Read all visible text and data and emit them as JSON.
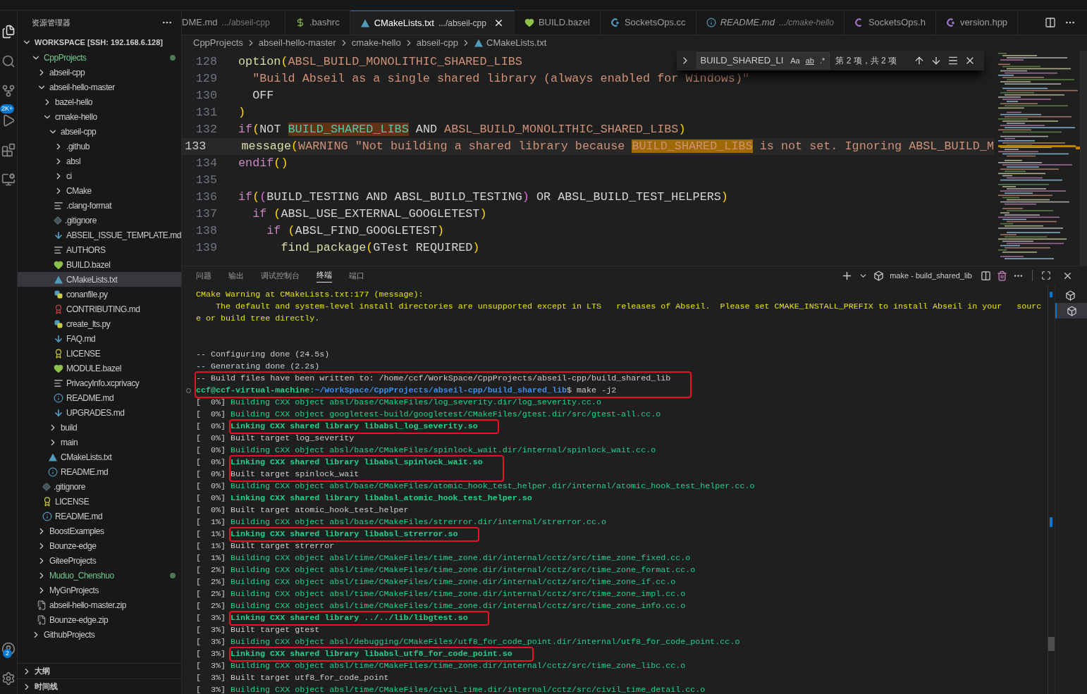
{
  "activity_bar": {
    "badges": [
      {
        "text": "2K+"
      },
      {
        "text": "2"
      }
    ]
  },
  "sidebar": {
    "title": "资源管理器",
    "workspace": {
      "label": "WORKSPACE [SSH: 192.168.6.128]",
      "expanded": true,
      "children": [
        {
          "label": "CppProjects",
          "kind": "folder",
          "expanded": true,
          "selected": false,
          "modified": true,
          "children": [
            {
              "label": "abseil-cpp",
              "kind": "folder",
              "expanded": false,
              "selected": false,
              "modified": false
            },
            {
              "label": "abseil-hello-master",
              "kind": "folder",
              "expanded": true,
              "selected": false,
              "modified": false,
              "children": [
                {
                  "label": "bazel-hello",
                  "kind": "folder",
                  "expanded": false,
                  "selected": false,
                  "modified": false
                },
                {
                  "label": "cmake-hello",
                  "kind": "folder",
                  "expanded": true,
                  "selected": false,
                  "modified": false,
                  "children": [
                    {
                      "label": "abseil-cpp",
                      "kind": "folder",
                      "expanded": true,
                      "selected": false,
                      "modified": false,
                      "children": [
                        {
                          "label": ".github",
                          "kind": "folder",
                          "expanded": false,
                          "selected": false,
                          "modified": false
                        },
                        {
                          "label": "absl",
                          "kind": "folder",
                          "expanded": false,
                          "selected": false,
                          "modified": false
                        },
                        {
                          "label": "ci",
                          "kind": "folder",
                          "expanded": false,
                          "selected": false,
                          "modified": false
                        },
                        {
                          "label": "CMake",
                          "kind": "folder",
                          "expanded": false,
                          "selected": false,
                          "modified": false
                        },
                        {
                          "label": ".clang-format",
                          "kind": "lines",
                          "selected": false,
                          "modified": false
                        },
                        {
                          "label": ".gitignore",
                          "kind": "git",
                          "selected": false,
                          "modified": false
                        },
                        {
                          "label": "ABSEIL_ISSUE_TEMPLATE.md",
                          "kind": "markdown",
                          "selected": false,
                          "modified": false
                        },
                        {
                          "label": "AUTHORS",
                          "kind": "lines",
                          "selected": false,
                          "modified": false
                        },
                        {
                          "label": "BUILD.bazel",
                          "kind": "bazel",
                          "selected": false,
                          "modified": false
                        },
                        {
                          "label": "CMakeLists.txt",
                          "kind": "cmake",
                          "selected": true,
                          "modified": false
                        },
                        {
                          "label": "conanfile.py",
                          "kind": "python",
                          "selected": false,
                          "modified": false
                        },
                        {
                          "label": "CONTRIBUTING.md",
                          "kind": "contributing",
                          "selected": false,
                          "modified": false
                        },
                        {
                          "label": "create_lts.py",
                          "kind": "python",
                          "selected": false,
                          "modified": false
                        },
                        {
                          "label": "FAQ.md",
                          "kind": "markdown",
                          "selected": false,
                          "modified": false
                        },
                        {
                          "label": "LICENSE",
                          "kind": "license",
                          "selected": false,
                          "modified": false
                        },
                        {
                          "label": "MODULE.bazel",
                          "kind": "bazel",
                          "selected": false,
                          "modified": false
                        },
                        {
                          "label": "PrivacyInfo.xcprivacy",
                          "kind": "lines",
                          "selected": false,
                          "modified": false
                        },
                        {
                          "label": "README.md",
                          "kind": "info",
                          "selected": false,
                          "modified": false
                        },
                        {
                          "label": "UPGRADES.md",
                          "kind": "markdown",
                          "selected": false,
                          "modified": false
                        }
                      ]
                    },
                    {
                      "label": "build",
                      "kind": "folder",
                      "expanded": false,
                      "selected": false,
                      "modified": false
                    },
                    {
                      "label": "main",
                      "kind": "folder",
                      "expanded": false,
                      "selected": false,
                      "modified": false
                    },
                    {
                      "label": "CMakeLists.txt",
                      "kind": "cmake",
                      "selected": false,
                      "modified": false
                    },
                    {
                      "label": "README.md",
                      "kind": "info",
                      "selected": false,
                      "modified": false
                    }
                  ]
                },
                {
                  "label": ".gitignore",
                  "kind": "git",
                  "selected": false,
                  "modified": false
                },
                {
                  "label": "LICENSE",
                  "kind": "license",
                  "selected": false,
                  "modified": false
                },
                {
                  "label": "README.md",
                  "kind": "info",
                  "selected": false,
                  "modified": false
                }
              ]
            },
            {
              "label": "BoostExamples",
              "kind": "folder",
              "expanded": false,
              "selected": false,
              "modified": false
            },
            {
              "label": "Bounze-edge",
              "kind": "folder",
              "expanded": false,
              "selected": false,
              "modified": false
            },
            {
              "label": "GiteeProjects",
              "kind": "folder",
              "expanded": false,
              "selected": false,
              "modified": false
            },
            {
              "label": "Muduo_Chenshuo",
              "kind": "folder",
              "expanded": false,
              "selected": false,
              "modified": true
            },
            {
              "label": "MyGnProjects",
              "kind": "folder",
              "expanded": false,
              "selected": false,
              "modified": false
            },
            {
              "label": "abseil-hello-master.zip",
              "kind": "zip",
              "selected": false,
              "modified": false
            },
            {
              "label": "Bounze-edge.zip",
              "kind": "zip",
              "selected": false,
              "modified": false
            }
          ]
        },
        {
          "label": "GithubProjects",
          "kind": "folder",
          "expanded": false,
          "selected": false,
          "modified": false
        }
      ]
    },
    "sections": [
      {
        "label": "大纲",
        "expanded": false
      },
      {
        "label": "时间线",
        "expanded": false
      }
    ]
  },
  "tabs": [
    {
      "label": "DME.md",
      "detail": ".../abseil-cpp",
      "selected": false,
      "preview": false
    },
    {
      "label": ".bashrc",
      "kind": "shell",
      "selected": false,
      "preview": false
    },
    {
      "label": "CMakeLists.txt",
      "detail": ".../abseil-cpp",
      "kind": "cmake",
      "selected": true,
      "preview": false
    },
    {
      "label": "BUILD.bazel",
      "kind": "bazel",
      "selected": false,
      "preview": false
    },
    {
      "label": "SocketsOps.cc",
      "kind": "cpp",
      "selected": false,
      "preview": false
    },
    {
      "label": "README.md",
      "detail": ".../cmake-hello",
      "kind": "info",
      "selected": false,
      "preview": true
    },
    {
      "label": "SocketsOps.h",
      "kind": "header",
      "selected": false,
      "preview": false
    },
    {
      "label": "version.hpp",
      "kind": "hpp",
      "selected": false,
      "preview": false
    }
  ],
  "breadcrumbs": [
    {
      "label": "CppProjects"
    },
    {
      "label": "abseil-hello-master"
    },
    {
      "label": "cmake-hello"
    },
    {
      "label": "abseil-cpp"
    },
    {
      "label": "CMakeLists.txt",
      "kind": "cmake"
    }
  ],
  "editor": {
    "lines": [
      {
        "number": "128",
        "current": false,
        "tokens": [
          {
            "kind": "function",
            "text": "option"
          },
          {
            "kind": "bracket",
            "text": "("
          },
          {
            "kind": "string",
            "text": "ABSL_BUILD_MONOLITHIC_SHARED_LIBS"
          }
        ]
      },
      {
        "number": "129",
        "current": false,
        "tokens": [
          {
            "kind": "string",
            "text": "  \"Build Abseil as a single shared library (always enabled for Windows)\""
          }
        ]
      },
      {
        "number": "130",
        "current": false,
        "tokens": [
          {
            "kind": "plain",
            "text": "  OFF"
          }
        ]
      },
      {
        "number": "131",
        "current": false,
        "tokens": [
          {
            "kind": "bracket",
            "text": ")"
          }
        ]
      },
      {
        "number": "132",
        "current": false,
        "tokens": [
          {
            "kind": "keyword",
            "text": "if"
          },
          {
            "kind": "bracket",
            "text": "("
          },
          {
            "kind": "plain",
            "text": "NOT "
          },
          {
            "kind": "match",
            "text": "BUILD_SHARED_LIBS"
          },
          {
            "kind": "plain",
            "text": " AND "
          },
          {
            "kind": "string",
            "text": "ABSL_BUILD_MONOLITHIC_SHARED_LIBS"
          },
          {
            "kind": "bracket",
            "text": ")"
          }
        ]
      },
      {
        "number": "133",
        "current": true,
        "tokens": [
          {
            "kind": "function",
            "text": "  message"
          },
          {
            "kind": "bracket",
            "text": "("
          },
          {
            "kind": "string",
            "text": "WARNING \"Not building a shared library because "
          },
          {
            "kind": "current_match",
            "text": "BUILD_SHARED_LIBS"
          },
          {
            "kind": "string",
            "text": " is not set. Ignoring ABSL_BUILD_M"
          }
        ]
      },
      {
        "number": "134",
        "current": false,
        "tokens": [
          {
            "kind": "keyword",
            "text": "endif"
          },
          {
            "kind": "bracket",
            "text": "()"
          }
        ]
      },
      {
        "number": "135",
        "current": false
      },
      {
        "number": "136",
        "current": false,
        "tokens": [
          {
            "kind": "keyword",
            "text": "if"
          },
          {
            "kind": "bracket",
            "text": "("
          },
          {
            "kind": "bracket2",
            "text": "("
          },
          {
            "kind": "plain",
            "text": "BUILD_TESTING AND ABSL_BUILD_TESTING"
          },
          {
            "kind": "bracket2",
            "text": ")"
          },
          {
            "kind": "plain",
            "text": " OR ABSL_BUILD_TEST_HELPERS"
          },
          {
            "kind": "bracket",
            "text": ")"
          }
        ]
      },
      {
        "number": "137",
        "current": false,
        "tokens": [
          {
            "kind": "keyword",
            "text": "  if"
          },
          {
            "kind": "bracket",
            "text": " ("
          },
          {
            "kind": "plain",
            "text": "ABSL_USE_EXTERNAL_GOOGLETEST"
          },
          {
            "kind": "bracket",
            "text": ")"
          }
        ]
      },
      {
        "number": "138",
        "current": false,
        "tokens": [
          {
            "kind": "keyword",
            "text": "    if"
          },
          {
            "kind": "bracket",
            "text": " ("
          },
          {
            "kind": "plain",
            "text": "ABSL_FIND_GOOGLETEST"
          },
          {
            "kind": "bracket",
            "text": ")"
          }
        ]
      },
      {
        "number": "139",
        "current": false,
        "tokens": [
          {
            "kind": "function",
            "text": "      find_package"
          },
          {
            "kind": "bracket",
            "text": "("
          },
          {
            "kind": "plain",
            "text": "GTest REQUIRED"
          },
          {
            "kind": "bracket",
            "text": ")"
          }
        ]
      }
    ]
  },
  "find_widget": {
    "query": "BUILD_SHARED_LI",
    "options": [
      {
        "label": "Aa",
        "underlined": false
      },
      {
        "label": "ab",
        "underlined": true
      },
      {
        "label": ".*",
        "underlined": false
      }
    ],
    "result": "第 2 项，共 2 项"
  },
  "panel": {
    "tabs": [
      {
        "label": "问题",
        "selected": false
      },
      {
        "label": "输出",
        "selected": false
      },
      {
        "label": "调试控制台",
        "selected": false
      },
      {
        "label": "终端",
        "selected": true
      },
      {
        "label": "端口",
        "selected": false
      }
    ],
    "terminal_name": "make - build_shared_lib",
    "terminal_instances": [
      {
        "selected": false
      },
      {
        "selected": true
      }
    ],
    "entries": [
      {
        "boxed": false,
        "lines": [
          {
            "kind": "warning",
            "text": "CMake Warning at CMakeLists.txt:177 (message):"
          },
          {
            "kind": "warning",
            "text": "    The default and system-level install directories are unsupported except in LTS   releases of Abseil.  Please set CMAKE_INSTALL_PREFIX to install Abseil in your   sourc"
          },
          {
            "kind": "warning",
            "text": "e or build tree directly."
          },
          {
            "kind": "blank"
          },
          {
            "kind": "blank"
          },
          {
            "kind": "plain",
            "text": "-- Configuring done (24.5s)"
          },
          {
            "kind": "plain",
            "text": "-- Generating done (2.2s)"
          }
        ]
      },
      {
        "boxed": true,
        "lines": [
          {
            "kind": "plain",
            "text": "-- Build files have been written to: /home/ccf/WorkSpace/CppProjects/abseil-cpp/build_shared_lib"
          },
          {
            "kind": "prompt",
            "user": "ccf@ccf-virtual-machine:",
            "path": "~/WorkSpace/CppProjects/abseil-cpp/build_shared_lib",
            "command": "$ make -j2"
          }
        ]
      },
      {
        "boxed": false,
        "lines": [
          {
            "kind": "build",
            "progress": "[  0%]",
            "text": "Building CXX object absl/base/CMakeFiles/log_severity.dir/log_severity.cc.o"
          },
          {
            "kind": "build",
            "progress": "[  0%]",
            "text": "Building CXX object googletest-build/googletest/CMakeFiles/gtest.dir/src/gtest-all.cc.o"
          }
        ]
      },
      {
        "boxed": true,
        "lines": [
          {
            "kind": "link",
            "progress": "[  0%]",
            "text": "Linking CXX shared library libabsl_log_severity.so"
          }
        ]
      },
      {
        "boxed": false,
        "lines": [
          {
            "kind": "target",
            "progress": "[  0%]",
            "text": "Built target log_severity"
          },
          {
            "kind": "build",
            "progress": "[  0%]",
            "text": "Building CXX object absl/base/CMakeFiles/spinlock_wait.dir/internal/spinlock_wait.cc.o"
          }
        ]
      },
      {
        "boxed": true,
        "lines": [
          {
            "kind": "link",
            "progress": "[  0%]",
            "text": "Linking CXX shared library libabsl_spinlock_wait.so"
          },
          {
            "kind": "target",
            "progress": "[  0%]",
            "text": "Built target spinlock_wait"
          }
        ]
      },
      {
        "boxed": false,
        "lines": [
          {
            "kind": "build",
            "progress": "[  0%]",
            "text": "Building CXX object absl/base/CMakeFiles/atomic_hook_test_helper.dir/internal/atomic_hook_test_helper.cc.o"
          },
          {
            "kind": "link",
            "progress": "[  0%]",
            "text": "Linking CXX shared library libabsl_atomic_hook_test_helper.so"
          },
          {
            "kind": "target",
            "progress": "[  0%]",
            "text": "Built target atomic_hook_test_helper"
          },
          {
            "kind": "build",
            "progress": "[  1%]",
            "text": "Building CXX object absl/base/CMakeFiles/strerror.dir/internal/strerror.cc.o"
          }
        ]
      },
      {
        "boxed": true,
        "lines": [
          {
            "kind": "link",
            "progress": "[  1%]",
            "text": "Linking CXX shared library libabsl_strerror.so"
          }
        ]
      },
      {
        "boxed": false,
        "lines": [
          {
            "kind": "target",
            "progress": "[  1%]",
            "text": "Built target strerror"
          },
          {
            "kind": "build",
            "progress": "[  1%]",
            "text": "Building CXX object absl/time/CMakeFiles/time_zone.dir/internal/cctz/src/time_zone_fixed.cc.o"
          },
          {
            "kind": "build",
            "progress": "[  2%]",
            "text": "Building CXX object absl/time/CMakeFiles/time_zone.dir/internal/cctz/src/time_zone_format.cc.o"
          },
          {
            "kind": "build",
            "progress": "[  2%]",
            "text": "Building CXX object absl/time/CMakeFiles/time_zone.dir/internal/cctz/src/time_zone_if.cc.o"
          },
          {
            "kind": "build",
            "progress": "[  2%]",
            "text": "Building CXX object absl/time/CMakeFiles/time_zone.dir/internal/cctz/src/time_zone_impl.cc.o"
          },
          {
            "kind": "build",
            "progress": "[  2%]",
            "text": "Building CXX object absl/time/CMakeFiles/time_zone.dir/internal/cctz/src/time_zone_info.cc.o"
          }
        ]
      },
      {
        "boxed": true,
        "lines": [
          {
            "kind": "link",
            "progress": "[  3%]",
            "text": "Linking CXX shared library ../../lib/libgtest.so"
          }
        ]
      },
      {
        "boxed": false,
        "lines": [
          {
            "kind": "target",
            "progress": "[  3%]",
            "text": "Built target gtest"
          },
          {
            "kind": "build",
            "progress": "[  3%]",
            "text": "Building CXX object absl/debugging/CMakeFiles/utf8_for_code_point.dir/internal/utf8_for_code_point.cc.o"
          }
        ]
      },
      {
        "boxed": true,
        "lines": [
          {
            "kind": "link",
            "progress": "[  3%]",
            "text": "Linking CXX shared library libabsl_utf8_for_code_point.so"
          }
        ]
      },
      {
        "boxed": false,
        "lines": [
          {
            "kind": "build",
            "progress": "[  3%]",
            "text": "Building CXX object absl/time/CMakeFiles/time_zone.dir/internal/cctz/src/time_zone_libc.cc.o"
          },
          {
            "kind": "target",
            "progress": "[  3%]",
            "text": "Built target utf8_for_code_point"
          },
          {
            "kind": "build",
            "progress": "[  3%]",
            "text": "Building CXX object absl/time/CMakeFiles/civil_time.dir/internal/cctz/src/civil_time_detail.cc.o"
          }
        ]
      }
    ]
  }
}
